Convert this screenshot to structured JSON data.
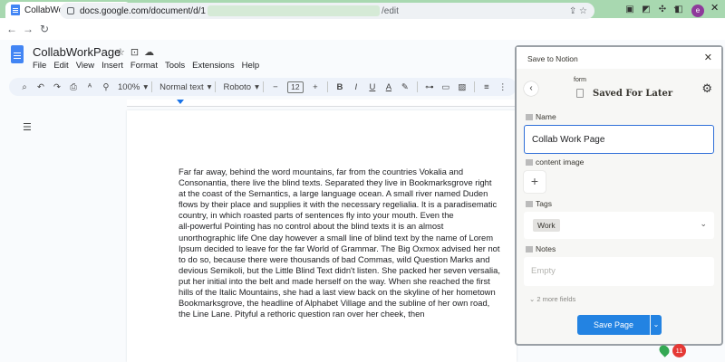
{
  "browser": {
    "tab_title": "CollabWorkPage - Google Docs",
    "url_base": "docs.google.com/document/d/1",
    "url_tail": "/edit"
  },
  "docs": {
    "title": "CollabWorkPage",
    "menu": [
      "File",
      "Edit",
      "View",
      "Insert",
      "Format",
      "Tools",
      "Extensions",
      "Help"
    ],
    "toolbar": {
      "zoom": "100%",
      "style": "Normal text",
      "font": "Roboto",
      "font_size": "12"
    },
    "body_lines": [
      "Far far away, behind the word mountains, far from the countries Vokalia and",
      "Consonantia, there live the blind texts. Separated they live in Bookmarksgrove right",
      "at the coast of the Semantics, a large language ocean. A small river named Duden",
      "flows by their place and supplies it with the necessary regelialia. It is a paradisematic",
      "country, in which roasted parts of sentences fly into your mouth. Even the",
      "all-powerful Pointing has no control about the blind texts it is an almost",
      "unorthographic life One day however a small line of blind text by the name of Lorem",
      "Ipsum decided to leave for the far World of Grammar. The Big Oxmox advised her not",
      "to do so, because there were thousands of bad Commas, wild Question Marks and",
      "devious Semikoli, but the Little Blind Text didn't listen. She packed her seven versalia,",
      "put her initial into the belt and made herself on the way. When she reached the first",
      "hills of the Italic Mountains, she had a last view back on the skyline of her hometown",
      "Bookmarksgrove, the headline of Alphabet Village and the subline of her own road,",
      "the Line Lane. Pityful a rethoric question ran over her cheek, then"
    ]
  },
  "notion": {
    "header": "Save to Notion",
    "form_label": "form",
    "database": "Saved For Later",
    "name_label": "Name",
    "name_value": "Collab Work Page",
    "image_label": "content image",
    "tags_label": "Tags",
    "tag_value": "Work",
    "notes_label": "Notes",
    "notes_placeholder": "Empty",
    "more_fields": "2 more fields",
    "save_label": "Save Page"
  },
  "badge_count": "11"
}
